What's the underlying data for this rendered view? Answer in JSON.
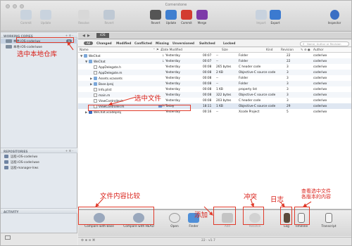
{
  "window": {
    "title": "Cornerstone"
  },
  "toolbar": {
    "buttons": [
      {
        "label": "Commit",
        "enabled": true
      },
      {
        "label": "Update",
        "enabled": true
      },
      {
        "label": "Resolve",
        "enabled": false
      },
      {
        "label": "Revert",
        "enabled": true
      },
      {
        "label": "Update",
        "enabled": true
      },
      {
        "label": "Commit",
        "enabled": true
      },
      {
        "label": "Merge",
        "enabled": true
      },
      {
        "label": "Import",
        "enabled": false
      },
      {
        "label": "Export",
        "enabled": true
      },
      {
        "label": "Inspector",
        "enabled": true
      }
    ]
  },
  "sidebar": {
    "working_copies_header": "WORKING COPIES",
    "working_copies_controls": "+ ✲ -",
    "working_copies": [
      {
        "label": "本地-iOS-coderiwx",
        "badge": "3",
        "selected": true
      },
      {
        "label": "本地-iOS-coderiwxe",
        "badge": "",
        "selected": false
      }
    ],
    "repositories_header": "REPOSITORIES",
    "repositories_controls": "+ ✲ -",
    "repositories": [
      {
        "label": "远程-iOS-coderiwx"
      },
      {
        "label": "远程-iOS-coderiwxe"
      },
      {
        "label": "远程-manager-lrws"
      }
    ],
    "activity_header": "ACTIVITY"
  },
  "nav": {
    "back": "◀",
    "forward": "▶",
    "crumb": "iOS"
  },
  "filters": {
    "all": "All",
    "items": [
      "Changed",
      "Modified",
      "Conflicted",
      "Missing",
      "Unversioned",
      "Switched",
      "Locked"
    ],
    "search_placeholder": "Name, Author or Revision"
  },
  "table": {
    "columns": [
      "Name",
      "Date Modified",
      "Size",
      "Kind",
      "Revision",
      "Author"
    ],
    "rows": [
      {
        "indent": 0,
        "tri": "▼",
        "icon": "folder",
        "name": "WeChat",
        "date": "Yesterday",
        "time": "00:07",
        "size": "--",
        "kind": "Folder",
        "rev": "22",
        "author": "coderiwx",
        "flag": "↓"
      },
      {
        "indent": 1,
        "tri": "▼",
        "icon": "folder",
        "name": "WeChat",
        "date": "Yesterday",
        "time": "00:07",
        "size": "--",
        "kind": "Folder",
        "rev": "22",
        "author": "coderiwx",
        "flag": "↓"
      },
      {
        "indent": 2,
        "tri": "",
        "icon": "file",
        "name": "AppDelegate.h",
        "date": "Yesterday",
        "time": "00:08",
        "size": "265 bytes",
        "kind": "C header code",
        "rev": "3",
        "author": "coderiwx",
        "flag": ""
      },
      {
        "indent": 2,
        "tri": "",
        "icon": "file",
        "name": "AppDelegate.m",
        "date": "Yesterday",
        "time": "00:08",
        "size": "2 KB",
        "kind": "Objective-C source code",
        "rev": "3",
        "author": "coderiwx",
        "flag": ""
      },
      {
        "indent": 2,
        "tri": "▶",
        "icon": "folder",
        "name": "Assets.xcassets",
        "date": "Yesterday",
        "time": "00:08",
        "size": "--",
        "kind": "Folder",
        "rev": "3",
        "author": "coderiwx",
        "flag": ""
      },
      {
        "indent": 2,
        "tri": "▶",
        "icon": "folder",
        "name": "Base.lproj",
        "date": "Yesterday",
        "time": "00:08",
        "size": "--",
        "kind": "Folder",
        "rev": "3",
        "author": "coderiwx",
        "flag": ""
      },
      {
        "indent": 2,
        "tri": "",
        "icon": "file",
        "name": "Info.plist",
        "date": "Yesterday",
        "time": "00:08",
        "size": "1 KB",
        "kind": "property list",
        "rev": "3",
        "author": "coderiwx",
        "flag": ""
      },
      {
        "indent": 2,
        "tri": "",
        "icon": "file",
        "name": "main.m",
        "date": "Yesterday",
        "time": "00:08",
        "size": "322 bytes",
        "kind": "Objective-C source code",
        "rev": "3",
        "author": "coderiwx",
        "flag": ""
      },
      {
        "indent": 2,
        "tri": "",
        "icon": "file",
        "name": "ViewController.h",
        "date": "Yesterday",
        "time": "00:08",
        "size": "203 bytes",
        "kind": "C header code",
        "rev": "3",
        "author": "coderiwx",
        "flag": ""
      },
      {
        "indent": 2,
        "tri": "",
        "icon": "file",
        "name": "ViewController.m",
        "date": "Today",
        "time": "18:11",
        "size": "1 KB",
        "kind": "Objective-C source code",
        "rev": "29",
        "author": "coderiwx",
        "flag": "M"
      },
      {
        "indent": 1,
        "tri": "▶",
        "icon": "proj",
        "name": "WeChat.xcodeproj",
        "date": "Yesterday",
        "time": "00:16",
        "size": "--",
        "kind": "Xcode Project",
        "rev": "5",
        "author": "coderiwx",
        "flag": ""
      }
    ]
  },
  "bottom_toolbar": {
    "buttons": [
      {
        "label": "Compare with Base",
        "enabled": true
      },
      {
        "label": "Compare with HEAD",
        "enabled": true
      },
      {
        "label": "Open",
        "enabled": true
      },
      {
        "label": "Finder",
        "enabled": true
      },
      {
        "label": "Add",
        "enabled": false
      },
      {
        "label": "Resolve",
        "enabled": false
      },
      {
        "label": "Log",
        "enabled": true
      },
      {
        "label": "Timeline",
        "enabled": true
      },
      {
        "label": "Transcript",
        "enabled": true
      }
    ]
  },
  "status": {
    "icons": "⚙  ⊕  ⊖  ⌘",
    "revision": "22 · v1.7"
  },
  "annotations": {
    "select_local_repo": "选中本地仓库",
    "select_file": "选中文件",
    "compare_file": "文件内容比较",
    "add": "添加",
    "conflict": "冲突",
    "log": "日志",
    "view_all_versions": "查看选中文件\n各版本的内容"
  },
  "colors": {
    "annotation_red": "#d9211a",
    "selection": "#c6d3e3"
  }
}
